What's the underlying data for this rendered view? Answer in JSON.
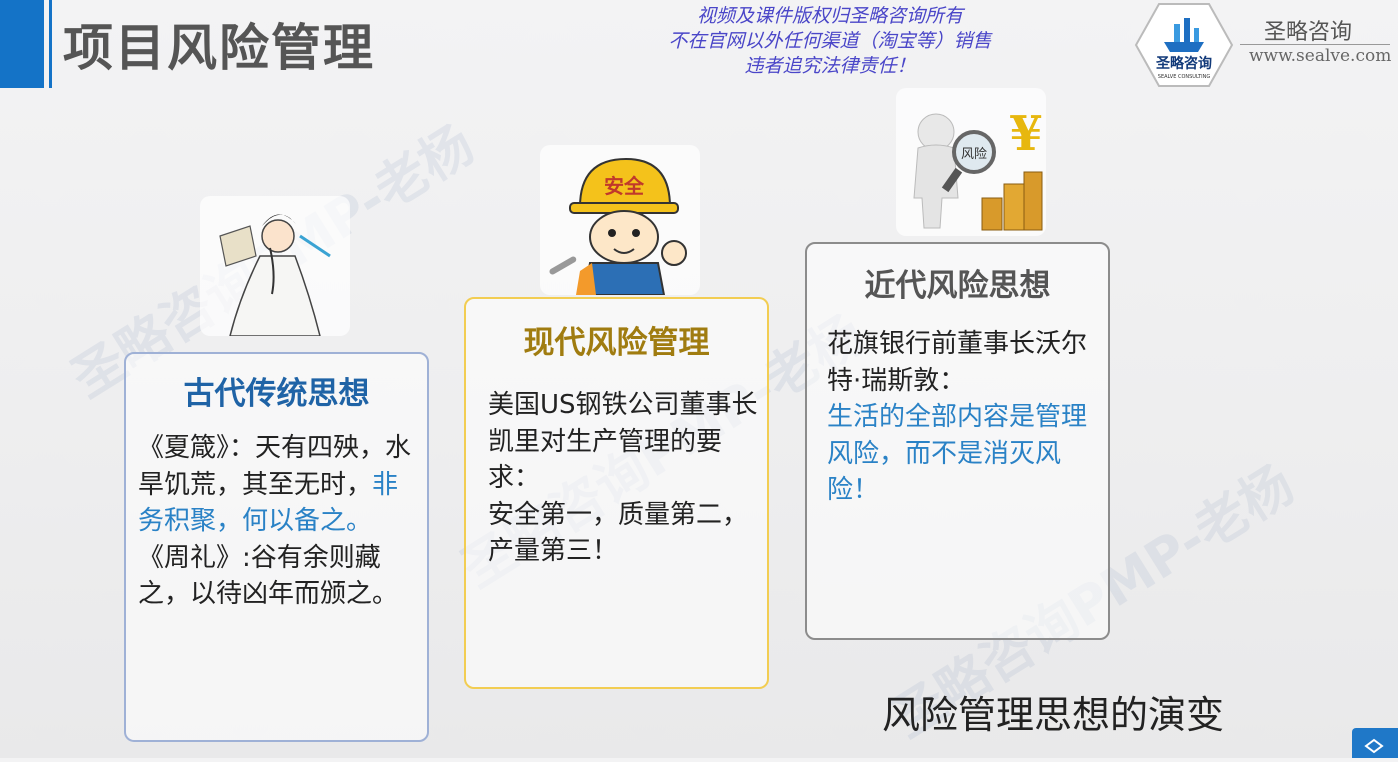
{
  "slide": {
    "title": "项目风险管理",
    "copyright_lines": [
      "视频及课件版权归圣略咨询所有",
      "不在官网以外任何渠道（淘宝等）销售",
      "违者追究法律责任！"
    ],
    "brand": {
      "logo_text": "圣略咨询",
      "logo_subtext": "SEALVE CONSULTING",
      "name": "圣略咨询",
      "url": "www.sealve.com"
    },
    "watermark": "圣略咨询PMP-老杨",
    "subtitle": "风险管理思想的演变"
  },
  "cards": {
    "ancient": {
      "title": "古代传统思想",
      "p1_normal": "《夏箴》：天有四殃，水旱饥荒，其至无时，",
      "p1_highlight": "非务积聚，何以备之。",
      "p2": "《周礼》:谷有余则藏之，以待凶年而颁之。"
    },
    "modern": {
      "title": "现代风险管理",
      "p1": "美国US钢铁公司董事长凯里对生产管理的要求：",
      "p2": "安全第一，质量第二，产量第三！"
    },
    "recent": {
      "title": "近代风险思想",
      "p1": "花旗银行前董事长沃尔特·瑞斯敦：",
      "p2_highlight": "生活的全部内容是管理风险，而不是消灭风险！"
    }
  },
  "illustrations": {
    "safety_helmet_text": "安全",
    "risk_magnifier_text": "风险"
  },
  "colors": {
    "accent_blue": "#1473c7",
    "highlight_blue": "#2a82c6",
    "modern_gold": "#f2cd52",
    "copyright_purple": "#4a46c8"
  }
}
